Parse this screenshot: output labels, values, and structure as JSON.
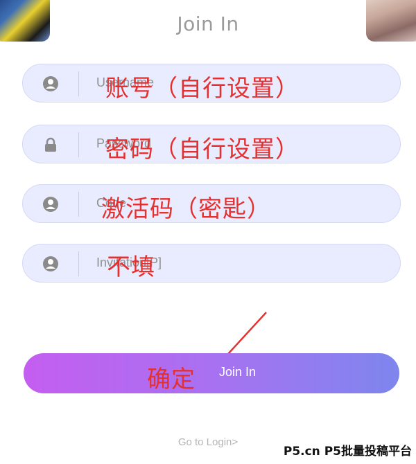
{
  "header": {
    "title": "Join In"
  },
  "fields": [
    {
      "placeholder": "Username",
      "icon": "user-icon",
      "annotation": "账号（自行设置）"
    },
    {
      "placeholder": "Password",
      "icon": "lock-icon",
      "annotation": "密码（自行设置）"
    },
    {
      "placeholder": "Code",
      "icon": "user-icon",
      "annotation": "激活码（密匙）"
    },
    {
      "placeholder": "Invitation[P]",
      "icon": "user-icon",
      "annotation": "不填"
    }
  ],
  "submit": {
    "label": "Join In",
    "annotation": "确定"
  },
  "footer": {
    "go_login": "Go to Login>"
  },
  "watermark": "P5.cn P5批量投稿平台",
  "colors": {
    "field_bg": "#e9ecff",
    "button_gradient": [
      "#c45ef0",
      "#7e86ee"
    ],
    "annotation": "#e53030"
  }
}
